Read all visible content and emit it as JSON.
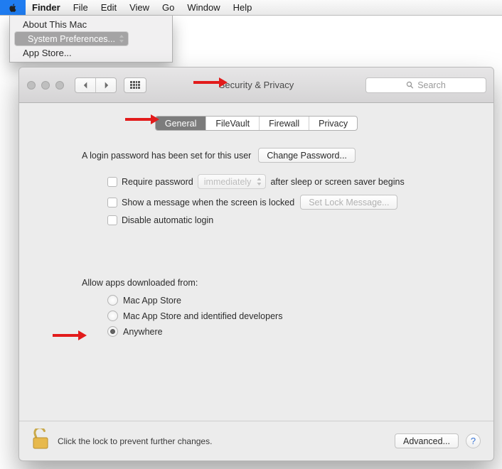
{
  "menubar": {
    "items": [
      {
        "label": "Finder",
        "bold": true
      },
      {
        "label": "File"
      },
      {
        "label": "Edit"
      },
      {
        "label": "View"
      },
      {
        "label": "Go"
      },
      {
        "label": "Window"
      },
      {
        "label": "Help"
      }
    ]
  },
  "apple_menu": {
    "items": [
      {
        "label": "About This Mac"
      },
      {
        "label": "System Preferences...",
        "selected": true
      },
      {
        "label": "App Store..."
      }
    ]
  },
  "window": {
    "title": "Security & Privacy",
    "search_placeholder": "Search",
    "tabs": [
      {
        "label": "General",
        "active": true
      },
      {
        "label": "FileVault"
      },
      {
        "label": "Firewall"
      },
      {
        "label": "Privacy"
      }
    ],
    "login_text": "A login password has been set for this user",
    "change_password_btn": "Change Password...",
    "require_pw_label": "Require password",
    "require_pw_delay": "immediately",
    "require_pw_suffix": "after sleep or screen saver begins",
    "show_msg_label": "Show a message when the screen is locked",
    "set_lock_msg_btn": "Set Lock Message...",
    "disable_auto_label": "Disable automatic login",
    "allow_apps_label": "Allow apps downloaded from:",
    "radio_options": [
      {
        "label": "Mac App Store",
        "checked": false
      },
      {
        "label": "Mac App Store and identified developers",
        "checked": false
      },
      {
        "label": "Anywhere",
        "checked": true
      }
    ],
    "lock_text": "Click the lock to prevent further changes.",
    "advanced_btn": "Advanced...",
    "help_btn": "?"
  }
}
